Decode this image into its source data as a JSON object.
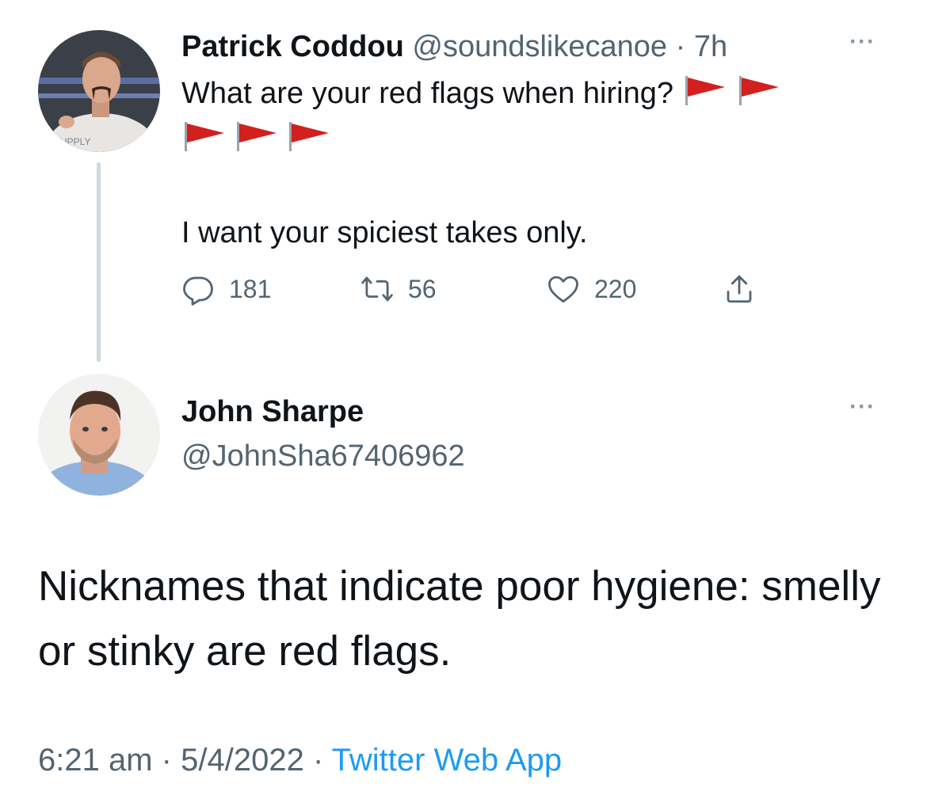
{
  "original_tweet": {
    "author_name": "Patrick Coddou",
    "author_handle": "@soundslikecanoe",
    "separator": "·",
    "time_ago": "7h",
    "more_label": "···",
    "text_line1": "What are your red flags when hiring?",
    "text_line2": "I want your spiciest takes only.",
    "flag_emoji": "triangular-flag-icon",
    "avatar_shirt_text": "SUPPLY",
    "stats": {
      "replies": "181",
      "retweets": "56",
      "likes": "220"
    }
  },
  "reply_tweet": {
    "author_name": "John Sharpe",
    "author_handle": "@JohnSha67406962",
    "more_label": "···",
    "text": "Nicknames that indicate poor hygiene: smelly or stinky are red flags.",
    "time": "6:21 am",
    "date": "5/4/2022",
    "separator": "·",
    "source": "Twitter Web App"
  },
  "colors": {
    "text_primary": "#0f1419",
    "text_muted": "#536471",
    "link": "#1d9bf0",
    "thread_line": "#cfd9de",
    "flag_red": "#d2201e"
  }
}
